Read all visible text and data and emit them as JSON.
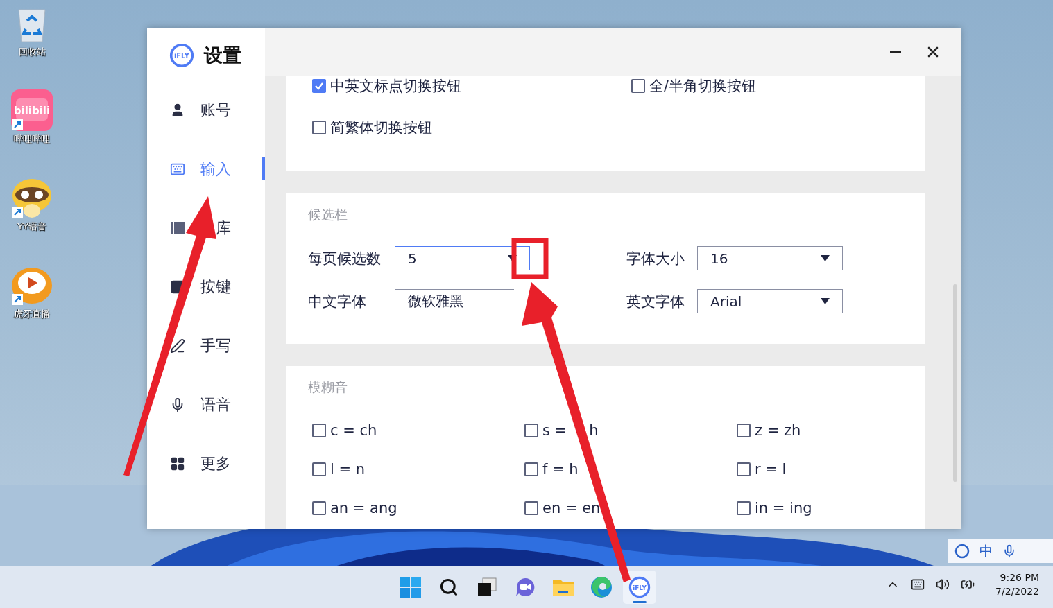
{
  "desktop_icons": [
    {
      "kind": "recycle",
      "label": "回收站"
    },
    {
      "kind": "bilibili",
      "label": "哔哩哔哩",
      "logo_text": "bilibili"
    },
    {
      "kind": "raccoon",
      "label": "YY语音"
    },
    {
      "kind": "tiger",
      "label": "虎牙直播"
    }
  ],
  "window": {
    "title": "设置",
    "logo_text": "iFLY"
  },
  "sidebar": {
    "items": [
      {
        "kind": "user",
        "label": "账号",
        "selected": false
      },
      {
        "kind": "keyboard",
        "label": "输入",
        "selected": true
      },
      {
        "kind": "dictionary",
        "label": "库",
        "selected": false
      },
      {
        "kind": "key",
        "label": "按键",
        "selected": false
      },
      {
        "kind": "pen",
        "label": "手写",
        "selected": false
      },
      {
        "kind": "mic",
        "label": "语音",
        "selected": false
      },
      {
        "kind": "grid",
        "label": "更多",
        "selected": false
      }
    ]
  },
  "toolbar_options": [
    {
      "label": "中英文标点切换按钮",
      "checked": true
    },
    {
      "label": "全/半角切换按钮",
      "checked": false
    },
    {
      "label": "简繁体切换按钮",
      "checked": false
    }
  ],
  "candidate_bar": {
    "title": "候选栏",
    "fields": [
      {
        "label": "每页候选数",
        "value": "5",
        "selected": true
      },
      {
        "label": "字体大小",
        "value": "16",
        "selected": false
      },
      {
        "label": "中文字体",
        "value": "微软雅黑",
        "selected": false,
        "caret_hidden": true
      },
      {
        "label": "英文字体",
        "value": "Arial",
        "selected": false
      }
    ]
  },
  "fuzzy_pinyin": {
    "title": "模糊音",
    "options": [
      {
        "label": "c = ch",
        "checked": false
      },
      {
        "label": "s =",
        "tail": "h",
        "checked": false
      },
      {
        "label": "z = zh",
        "checked": false
      },
      {
        "label": "l = n",
        "checked": false
      },
      {
        "label": "f = h",
        "checked": false
      },
      {
        "label": "r = l",
        "checked": false
      },
      {
        "label": "an = ang",
        "checked": false
      },
      {
        "label": "en = en",
        "checked": false
      },
      {
        "label": "in = ing",
        "checked": false
      }
    ]
  },
  "ime_toolbar": {
    "mode": "中"
  },
  "taskbar": {
    "apps": [
      {
        "kind": "start",
        "selected": false
      },
      {
        "kind": "search",
        "selected": false
      },
      {
        "kind": "taskview",
        "selected": false
      },
      {
        "kind": "chat",
        "selected": false
      },
      {
        "kind": "explorer",
        "selected": false
      },
      {
        "kind": "edge",
        "selected": false
      },
      {
        "kind": "ifly",
        "selected": true,
        "logo_text": "iFLY"
      }
    ],
    "time": "9:26 PM",
    "date": "7/2/2022"
  }
}
